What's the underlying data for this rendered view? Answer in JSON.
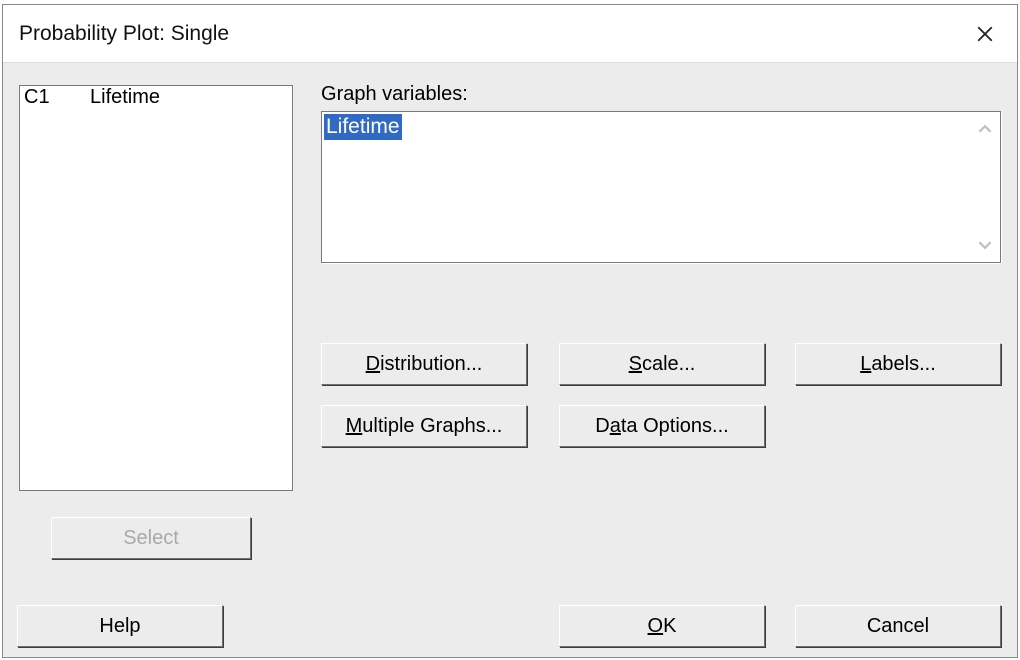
{
  "window": {
    "title": "Probability Plot: Single"
  },
  "columns": [
    {
      "id": "C1",
      "name": "Lifetime"
    }
  ],
  "labels": {
    "graph_variables": "Graph variables:"
  },
  "graph_variables": {
    "value_selected": "Lifetime"
  },
  "buttons": {
    "distribution_pre": "D",
    "distribution_post": "istribution...",
    "scale_pre": "S",
    "scale_post": "cale...",
    "labels_pre": "L",
    "labels_post": "abels...",
    "multiple_graphs_pre": "M",
    "multiple_graphs_post": "ultiple Graphs...",
    "data_options_pre": "D",
    "data_options_mid": "a",
    "data_options_post": "ta Options...",
    "select": "Select",
    "help": "Help",
    "ok_pre": "O",
    "ok_post": "K",
    "cancel": "Cancel"
  }
}
